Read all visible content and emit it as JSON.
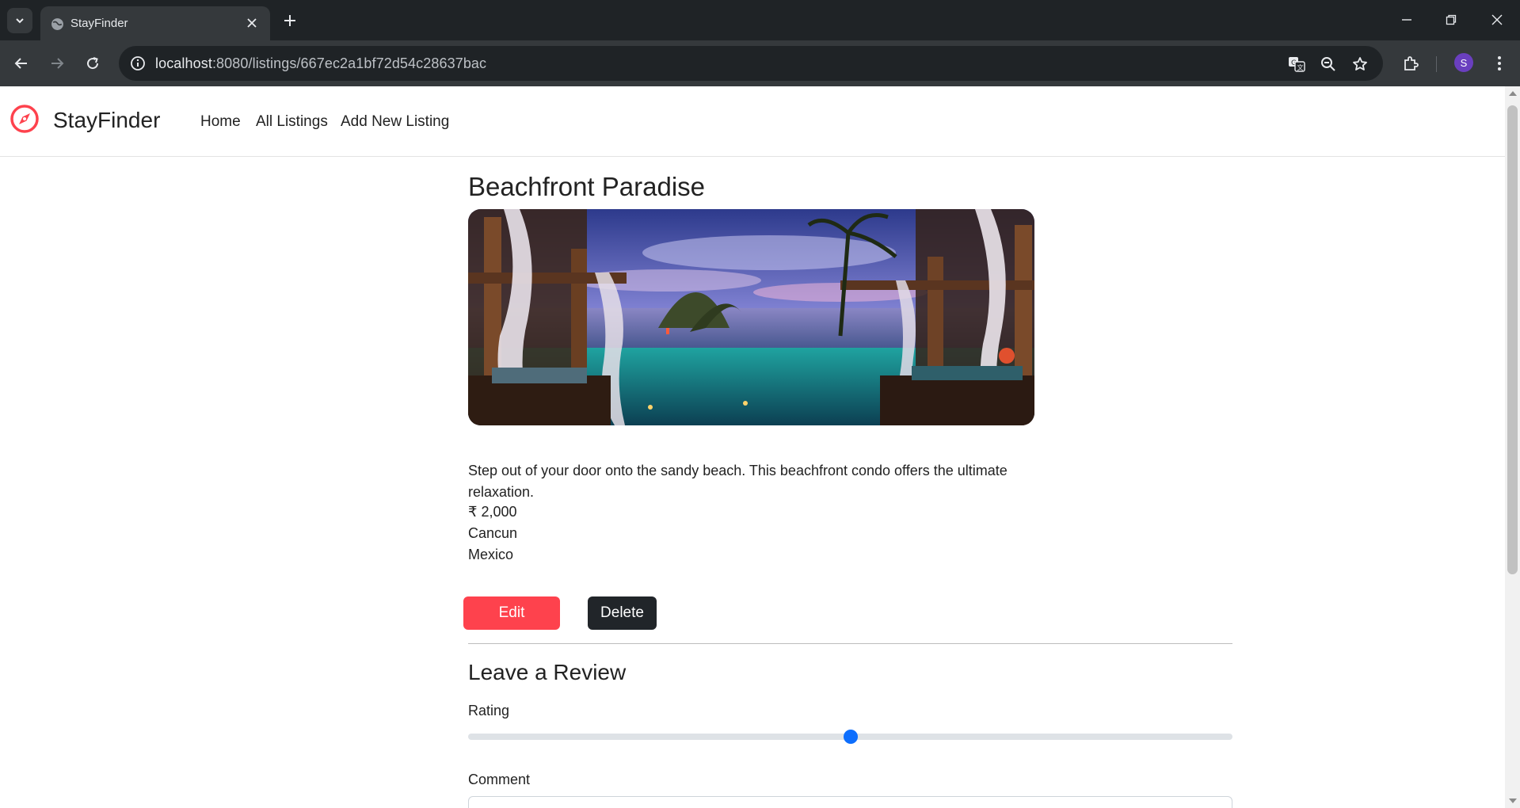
{
  "browser": {
    "tab_title": "StayFinder",
    "url_host": "localhost",
    "url_rest": ":8080/listings/667ec2a1bf72d54c28637bac",
    "profile_initial": "S"
  },
  "navbar": {
    "brand": "StayFinder",
    "links": [
      {
        "label": "Home"
      },
      {
        "label": "All Listings"
      },
      {
        "label": "Add New Listing"
      }
    ]
  },
  "listing": {
    "title": "Beachfront Paradise",
    "description": "Step out of your door onto the sandy beach. This beachfront condo offers the ultimate relaxation.",
    "price": "₹ 2,000",
    "location": "Cancun",
    "country": "Mexico"
  },
  "actions": {
    "edit_label": "Edit",
    "delete_label": "Delete"
  },
  "review": {
    "heading": "Leave a Review",
    "rating_label": "Rating",
    "rating_value_fraction": 0.5,
    "comment_label": "Comment",
    "comment_value": ""
  },
  "colors": {
    "brand": "#fe424d",
    "delete_button": "#212529",
    "slider_thumb": "#0d6efd"
  }
}
